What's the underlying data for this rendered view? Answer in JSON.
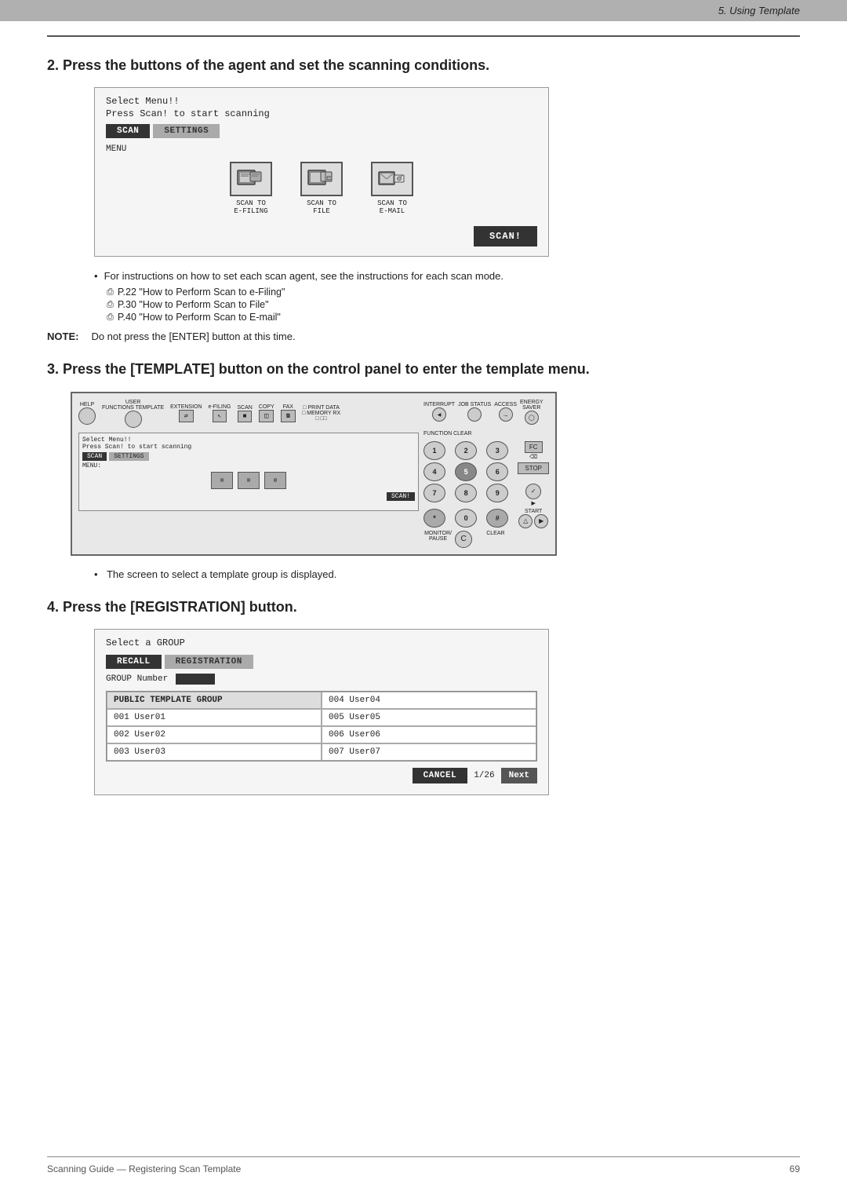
{
  "header": {
    "label": "5. Using Template"
  },
  "step2": {
    "heading": "Press the buttons of the agent and set the scanning conditions.",
    "number": "2.",
    "scanner_ui": {
      "title": "Select Menu!!",
      "subtitle": "Press Scan! to start scanning",
      "tab_scan": "SCAN",
      "tab_settings": "SETTINGS",
      "menu_label": "MENU",
      "icons": [
        {
          "label": "SCAN TO\nE-FILING"
        },
        {
          "label": "SCAN TO\nFILE"
        },
        {
          "label": "SCAN TO\nE-MAIL"
        }
      ],
      "scan_button": "SCAN!"
    },
    "bullet_main": "For instructions on how to set each scan agent, see the instructions for each scan mode.",
    "page_refs": [
      "P.22 \"How to Perform Scan to e-Filing\"",
      "P.30 \"How to Perform Scan to File\"",
      "P.40 \"How to Perform Scan to E-mail\""
    ]
  },
  "note": {
    "label": "NOTE:",
    "text": "Do not press the [ENTER] button at this time."
  },
  "step3": {
    "heading": "Press the [TEMPLATE] button on the control panel to enter the template menu.",
    "number": "3.",
    "panel": {
      "labels": {
        "help": "HELP",
        "user_functions": "USER\nFUNCTIONS TEMPLATE",
        "extension": "EXTENSION",
        "efiling": "e-FILING",
        "scan": "SCAN",
        "copy": "COPY",
        "fax": "FAX",
        "print_data": "PRINT DATA",
        "memory_rx": "MEMORY RX",
        "interrupt": "INTERRUPT",
        "job_status": "JOB STATUS",
        "access": "ACCESS",
        "energy_saver": "ENERGY\nSAVER",
        "function_clear": "FUNCTION CLEAR",
        "fc": "FC",
        "stop": "STOP",
        "start": "START",
        "monitor_pause": "MONITOR/\nPAUSE",
        "clear": "CLEAR"
      },
      "numpad": [
        "1",
        "2",
        "3",
        "4",
        "5",
        "6",
        "7",
        "8",
        "9",
        "*",
        "0",
        "#",
        "C"
      ]
    },
    "screen_bullet": "The screen to select a template group is displayed."
  },
  "step4": {
    "heading": "Press the [REGISTRATION] button.",
    "number": "4.",
    "ui": {
      "title": "Select a GROUP",
      "tab_recall": "RECALL",
      "tab_registration": "REGISTRATION",
      "group_number_label": "GROUP Number",
      "rows": [
        {
          "left": "PUBLIC TEMPLATE GROUP",
          "right": "004 User04"
        },
        {
          "left": "001 User01",
          "right": "005 User05"
        },
        {
          "left": "002 User02",
          "right": "006 User06"
        },
        {
          "left": "003 User03",
          "right": "007 User07"
        }
      ],
      "cancel_button": "CANCEL",
      "page_info": "1/26",
      "next_button": "Next"
    }
  },
  "footer": {
    "left": "Scanning Guide — Registering Scan Template",
    "right": "69"
  }
}
